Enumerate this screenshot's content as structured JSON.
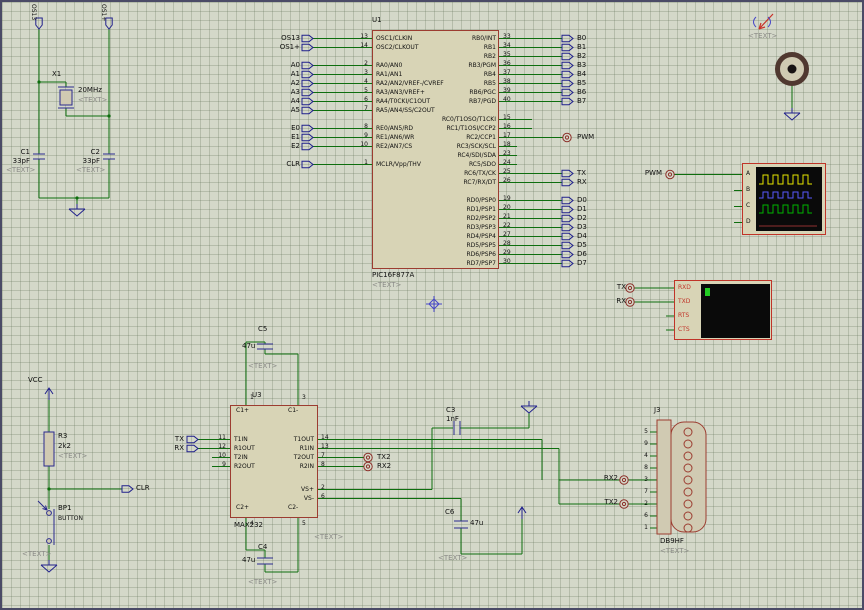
{
  "colors": {
    "background": "#d4d8c9",
    "grid": "#aab4a0",
    "wire_green": "#0e6e0e",
    "component_body": "#d8d4b6",
    "ic_outline": "#9c3c30",
    "discrete_outline": "#2a2a8e",
    "instrument_border": "#c03428",
    "terminal_blue": "#20208c",
    "screen_black": "#0a0a0a",
    "trace_yellow": "#e6e600",
    "trace_blue": "#5858ff",
    "trace_green": "#00b400",
    "cursor_green": "#22cc22",
    "note_gray": "#8a8a86"
  },
  "osc": {
    "term1": "OS13",
    "term2": "OS1+"
  },
  "x1": {
    "ref": "X1",
    "value": "20MHz",
    "note": "<TEXT>"
  },
  "c1": {
    "ref": "C1",
    "value": "33pF",
    "note": "<TEXT>"
  },
  "c2": {
    "ref": "C2",
    "value": "33pF",
    "note": "<TEXT>"
  },
  "u1": {
    "ref": "U1",
    "part": "PIC16F877A",
    "note": "<TEXT>",
    "left_terms": [
      "OS13",
      "OS1+",
      "",
      "A0",
      "A1",
      "A2",
      "A3",
      "A4",
      "A5",
      "",
      "E0",
      "E1",
      "E2",
      "",
      "CLR"
    ],
    "left_nums": [
      "13",
      "14",
      "",
      "2",
      "3",
      "4",
      "5",
      "6",
      "7",
      "",
      "8",
      "9",
      "10",
      "",
      "1"
    ],
    "left_names": [
      "OSC1/CLKIN",
      "OSC2/CLKOUT",
      "",
      "RA0/AN0",
      "RA1/AN1",
      "RA2/AN2/VREF-/CVREF",
      "RA3/AN3/VREF+",
      "RA4/T0CKI/C1OUT",
      "RA5/AN4/SS/C2OUT",
      "",
      "RE0/AN5/RD",
      "RE1/AN6/WR",
      "RE2/AN7/CS",
      "",
      "MCLR/Vpp/THV"
    ],
    "right_names": [
      "RB0/INT",
      "RB1",
      "RB2",
      "RB3/PGM",
      "RB4",
      "RB5",
      "RB6/PGC",
      "RB7/PGD",
      "",
      "RC0/T1OSO/T1CKI",
      "RC1/T1OSI/CCP2",
      "RC2/CCP1",
      "RC3/SCK/SCL",
      "RC4/SDI/SDA",
      "RC5/SDO",
      "RC6/TX/CK",
      "RC7/RX/DT",
      "",
      "RD0/PSP0",
      "RD1/PSP1",
      "RD2/PSP2",
      "RD3/PSP3",
      "RD4/PSP4",
      "RD5/PSP5",
      "RD6/PSP6",
      "RD7/PSP7"
    ],
    "right_nums": [
      "33",
      "34",
      "35",
      "36",
      "37",
      "38",
      "39",
      "40",
      "",
      "15",
      "16",
      "17",
      "18",
      "23",
      "24",
      "25",
      "26",
      "",
      "19",
      "20",
      "21",
      "22",
      "27",
      "28",
      "29",
      "30"
    ],
    "right_terms": [
      "B0",
      "B1",
      "B2",
      "B3",
      "B4",
      "B5",
      "B6",
      "B7",
      "",
      "",
      "",
      "PWM",
      "",
      "",
      "",
      "TX",
      "RX",
      "",
      "D0",
      "D1",
      "D2",
      "D3",
      "D4",
      "D5",
      "D6",
      "D7"
    ]
  },
  "vcc": {
    "label": "VCC"
  },
  "r3": {
    "ref": "R3",
    "value": "2k2",
    "note": "<TEXT>"
  },
  "bp1": {
    "ref": "BP1",
    "part": "BUTTON",
    "note": "<TEXT>"
  },
  "clr": {
    "label": "CLR"
  },
  "u3": {
    "ref": "U3",
    "part": "MAX232",
    "note": "<TEXT>",
    "left_terms": [
      "TX",
      "RX",
      "",
      ""
    ],
    "left_nums": [
      "11",
      "12",
      "10",
      "9"
    ],
    "left_names": [
      "T1IN",
      "R1OUT",
      "T2IN",
      "R2OUT"
    ],
    "right_names": [
      "T1OUT",
      "R1IN",
      "T2OUT",
      "R2IN"
    ],
    "right_nums": [
      "14",
      "13",
      "7",
      "8"
    ],
    "right_terms": [
      "",
      "",
      "TX2",
      "RX2"
    ],
    "vs_names": [
      "VS+",
      "VS-"
    ],
    "vs_nums": [
      "2",
      "6"
    ],
    "top_names": [
      "C1+",
      "C1-"
    ],
    "top_nums": [
      "1",
      "3"
    ],
    "bottom_names": [
      "C2+",
      "C2-"
    ],
    "bottom_nums": [
      "4",
      "5"
    ]
  },
  "c3": {
    "ref": "C3",
    "value": "1nF"
  },
  "c4": {
    "ref": "C4",
    "value": "47u",
    "note": "<TEXT>"
  },
  "c5": {
    "ref": "C5",
    "value": "47u",
    "note": "<TEXT>"
  },
  "c6": {
    "ref": "C6",
    "value": "47u",
    "note": "<TEXT>"
  },
  "j3": {
    "ref": "J3",
    "part": "DB9HF",
    "note": "<TEXT>",
    "pin_nums": [
      "5",
      "9",
      "4",
      "8",
      "3",
      "7",
      "2",
      "6",
      "1"
    ],
    "rx_term": "RX2",
    "tx_term": "TX2"
  },
  "scope": {
    "channels": [
      "A",
      "B",
      "C",
      "D"
    ],
    "input_term": "PWM"
  },
  "vterm": {
    "pins": [
      "RXD",
      "TXD",
      "RTS",
      "CTS"
    ],
    "tx_term": "TX",
    "rx_term": "RX"
  },
  "motor": {
    "note": "<TEXT>"
  }
}
